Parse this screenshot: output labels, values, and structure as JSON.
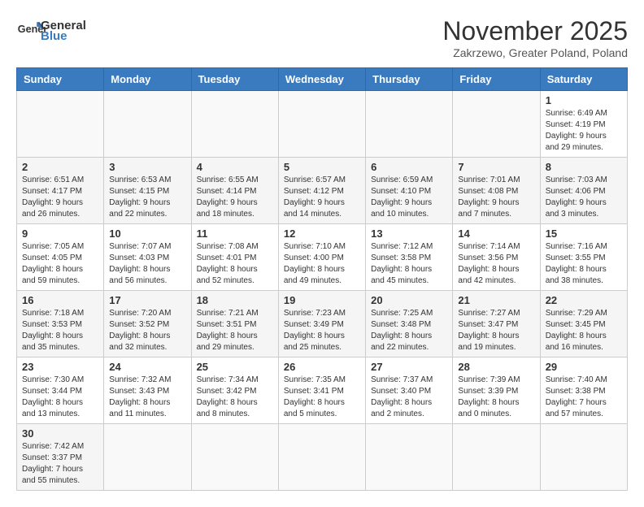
{
  "header": {
    "logo_general": "General",
    "logo_blue": "Blue",
    "month_title": "November 2025",
    "subtitle": "Zakrzewo, Greater Poland, Poland"
  },
  "days_of_week": [
    "Sunday",
    "Monday",
    "Tuesday",
    "Wednesday",
    "Thursday",
    "Friday",
    "Saturday"
  ],
  "weeks": [
    [
      {
        "day": "",
        "info": ""
      },
      {
        "day": "",
        "info": ""
      },
      {
        "day": "",
        "info": ""
      },
      {
        "day": "",
        "info": ""
      },
      {
        "day": "",
        "info": ""
      },
      {
        "day": "",
        "info": ""
      },
      {
        "day": "1",
        "info": "Sunrise: 6:49 AM\nSunset: 4:19 PM\nDaylight: 9 hours and 29 minutes."
      }
    ],
    [
      {
        "day": "2",
        "info": "Sunrise: 6:51 AM\nSunset: 4:17 PM\nDaylight: 9 hours and 26 minutes."
      },
      {
        "day": "3",
        "info": "Sunrise: 6:53 AM\nSunset: 4:15 PM\nDaylight: 9 hours and 22 minutes."
      },
      {
        "day": "4",
        "info": "Sunrise: 6:55 AM\nSunset: 4:14 PM\nDaylight: 9 hours and 18 minutes."
      },
      {
        "day": "5",
        "info": "Sunrise: 6:57 AM\nSunset: 4:12 PM\nDaylight: 9 hours and 14 minutes."
      },
      {
        "day": "6",
        "info": "Sunrise: 6:59 AM\nSunset: 4:10 PM\nDaylight: 9 hours and 10 minutes."
      },
      {
        "day": "7",
        "info": "Sunrise: 7:01 AM\nSunset: 4:08 PM\nDaylight: 9 hours and 7 minutes."
      },
      {
        "day": "8",
        "info": "Sunrise: 7:03 AM\nSunset: 4:06 PM\nDaylight: 9 hours and 3 minutes."
      }
    ],
    [
      {
        "day": "9",
        "info": "Sunrise: 7:05 AM\nSunset: 4:05 PM\nDaylight: 8 hours and 59 minutes."
      },
      {
        "day": "10",
        "info": "Sunrise: 7:07 AM\nSunset: 4:03 PM\nDaylight: 8 hours and 56 minutes."
      },
      {
        "day": "11",
        "info": "Sunrise: 7:08 AM\nSunset: 4:01 PM\nDaylight: 8 hours and 52 minutes."
      },
      {
        "day": "12",
        "info": "Sunrise: 7:10 AM\nSunset: 4:00 PM\nDaylight: 8 hours and 49 minutes."
      },
      {
        "day": "13",
        "info": "Sunrise: 7:12 AM\nSunset: 3:58 PM\nDaylight: 8 hours and 45 minutes."
      },
      {
        "day": "14",
        "info": "Sunrise: 7:14 AM\nSunset: 3:56 PM\nDaylight: 8 hours and 42 minutes."
      },
      {
        "day": "15",
        "info": "Sunrise: 7:16 AM\nSunset: 3:55 PM\nDaylight: 8 hours and 38 minutes."
      }
    ],
    [
      {
        "day": "16",
        "info": "Sunrise: 7:18 AM\nSunset: 3:53 PM\nDaylight: 8 hours and 35 minutes."
      },
      {
        "day": "17",
        "info": "Sunrise: 7:20 AM\nSunset: 3:52 PM\nDaylight: 8 hours and 32 minutes."
      },
      {
        "day": "18",
        "info": "Sunrise: 7:21 AM\nSunset: 3:51 PM\nDaylight: 8 hours and 29 minutes."
      },
      {
        "day": "19",
        "info": "Sunrise: 7:23 AM\nSunset: 3:49 PM\nDaylight: 8 hours and 25 minutes."
      },
      {
        "day": "20",
        "info": "Sunrise: 7:25 AM\nSunset: 3:48 PM\nDaylight: 8 hours and 22 minutes."
      },
      {
        "day": "21",
        "info": "Sunrise: 7:27 AM\nSunset: 3:47 PM\nDaylight: 8 hours and 19 minutes."
      },
      {
        "day": "22",
        "info": "Sunrise: 7:29 AM\nSunset: 3:45 PM\nDaylight: 8 hours and 16 minutes."
      }
    ],
    [
      {
        "day": "23",
        "info": "Sunrise: 7:30 AM\nSunset: 3:44 PM\nDaylight: 8 hours and 13 minutes."
      },
      {
        "day": "24",
        "info": "Sunrise: 7:32 AM\nSunset: 3:43 PM\nDaylight: 8 hours and 11 minutes."
      },
      {
        "day": "25",
        "info": "Sunrise: 7:34 AM\nSunset: 3:42 PM\nDaylight: 8 hours and 8 minutes."
      },
      {
        "day": "26",
        "info": "Sunrise: 7:35 AM\nSunset: 3:41 PM\nDaylight: 8 hours and 5 minutes."
      },
      {
        "day": "27",
        "info": "Sunrise: 7:37 AM\nSunset: 3:40 PM\nDaylight: 8 hours and 2 minutes."
      },
      {
        "day": "28",
        "info": "Sunrise: 7:39 AM\nSunset: 3:39 PM\nDaylight: 8 hours and 0 minutes."
      },
      {
        "day": "29",
        "info": "Sunrise: 7:40 AM\nSunset: 3:38 PM\nDaylight: 7 hours and 57 minutes."
      }
    ],
    [
      {
        "day": "30",
        "info": "Sunrise: 7:42 AM\nSunset: 3:37 PM\nDaylight: 7 hours and 55 minutes."
      },
      {
        "day": "",
        "info": ""
      },
      {
        "day": "",
        "info": ""
      },
      {
        "day": "",
        "info": ""
      },
      {
        "day": "",
        "info": ""
      },
      {
        "day": "",
        "info": ""
      },
      {
        "day": "",
        "info": ""
      }
    ]
  ]
}
